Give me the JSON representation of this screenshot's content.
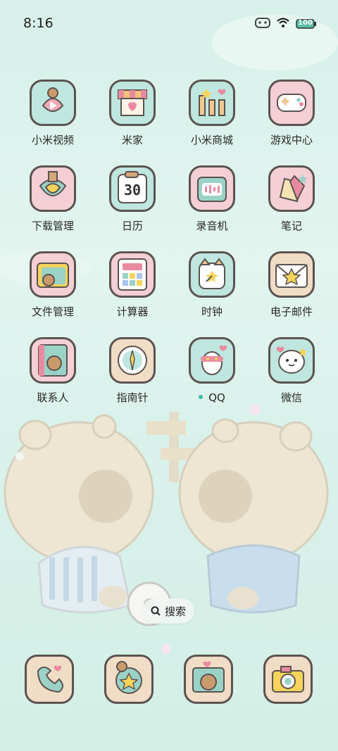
{
  "status_bar": {
    "time": "8:16",
    "icons": [
      "bear-signal-icon",
      "wifi-icon",
      "battery-icon"
    ],
    "battery_text": "100"
  },
  "apps": [
    {
      "label": "小米视频",
      "icon": "video-play-icon",
      "bg": "#bfe6df"
    },
    {
      "label": "米家",
      "icon": "shop-awning-icon",
      "bg": "#bfe6df"
    },
    {
      "label": "小米商城",
      "icon": "mi-store-icon",
      "bg": "#bfe6df"
    },
    {
      "label": "游戏中心",
      "icon": "gamepad-icon",
      "bg": "#f4cfd6"
    },
    {
      "label": "下载管理",
      "icon": "download-icon",
      "bg": "#f4cfd6"
    },
    {
      "label": "日历",
      "icon": "calendar-icon",
      "bg": "#bfe6df",
      "calendar_day": "30"
    },
    {
      "label": "录音机",
      "icon": "recorder-icon",
      "bg": "#f4cfd6"
    },
    {
      "label": "笔记",
      "icon": "pencil-note-icon",
      "bg": "#f4cfd6"
    },
    {
      "label": "文件管理",
      "icon": "folder-icon",
      "bg": "#f4cfd6"
    },
    {
      "label": "计算器",
      "icon": "calculator-icon",
      "bg": "#f4cfd6"
    },
    {
      "label": "时钟",
      "icon": "clock-icon",
      "bg": "#bfe6df"
    },
    {
      "label": "电子邮件",
      "icon": "mail-star-icon",
      "bg": "#f1dcc6"
    },
    {
      "label": "联系人",
      "icon": "contacts-book-icon",
      "bg": "#f4cfd6"
    },
    {
      "label": "指南针",
      "icon": "compass-icon",
      "bg": "#f1dcc6"
    },
    {
      "label": "QQ",
      "icon": "qq-penguin-icon",
      "bg": "#bfe6df",
      "new_dot": true
    },
    {
      "label": "微信",
      "icon": "wechat-bubble-icon",
      "bg": "#bfe6df"
    }
  ],
  "search": {
    "label": "搜索",
    "icon": "search-icon"
  },
  "dock": [
    {
      "icon": "phone-icon",
      "bg": "#f1dcc6"
    },
    {
      "icon": "messages-planet-icon",
      "bg": "#f1dcc6"
    },
    {
      "icon": "browser-capybara-icon",
      "bg": "#f1dcc6"
    },
    {
      "icon": "camera-icon",
      "bg": "#f1dcc6"
    }
  ]
}
